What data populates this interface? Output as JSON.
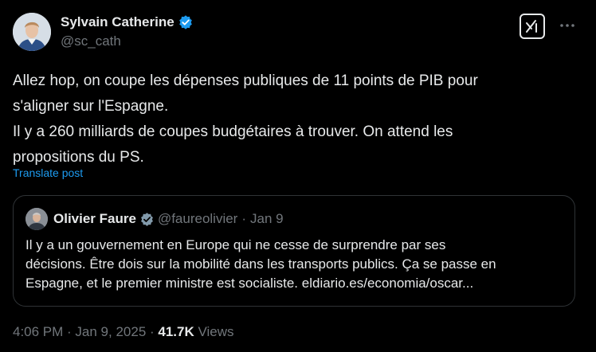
{
  "author": {
    "display_name": "Sylvain Catherine",
    "handle": "@sc_cath",
    "verified": true
  },
  "actions": {
    "grok_icon": "grok-icon",
    "more_icon": "more-icon"
  },
  "tweet": {
    "lines": [
      "Allez hop, on coupe les dépenses publiques de 11 points de PIB pour",
      "s'aligner sur l'Espagne.",
      "Il y a 260 milliards de coupes budgétaires à trouver. On attend les",
      "propositions du PS."
    ],
    "translate_label": "Translate post"
  },
  "quote": {
    "display_name": "Olivier Faure",
    "handle": "@faureolivier",
    "separator": "·",
    "date": "Jan 9",
    "verified_color": "#829aab",
    "lines": [
      "Il y a un gouvernement en Europe qui ne cesse de surprendre par ses",
      "décisions.  Être dois sur la mobilité dans les transports publics. Ça se passe en",
      "Espagne, et le premier ministre est socialiste.  eldiario.es/economia/oscar..."
    ]
  },
  "meta": {
    "time": "4:06 PM",
    "sep1": " · ",
    "date": "Jan 9, 2025",
    "sep2": " · ",
    "views_count": "41.7K",
    "views_label": " Views"
  },
  "colors": {
    "background": "#000000",
    "text": "#e7e9ea",
    "muted": "#71767b",
    "accent": "#1d9bf0",
    "border": "#2f3336"
  }
}
